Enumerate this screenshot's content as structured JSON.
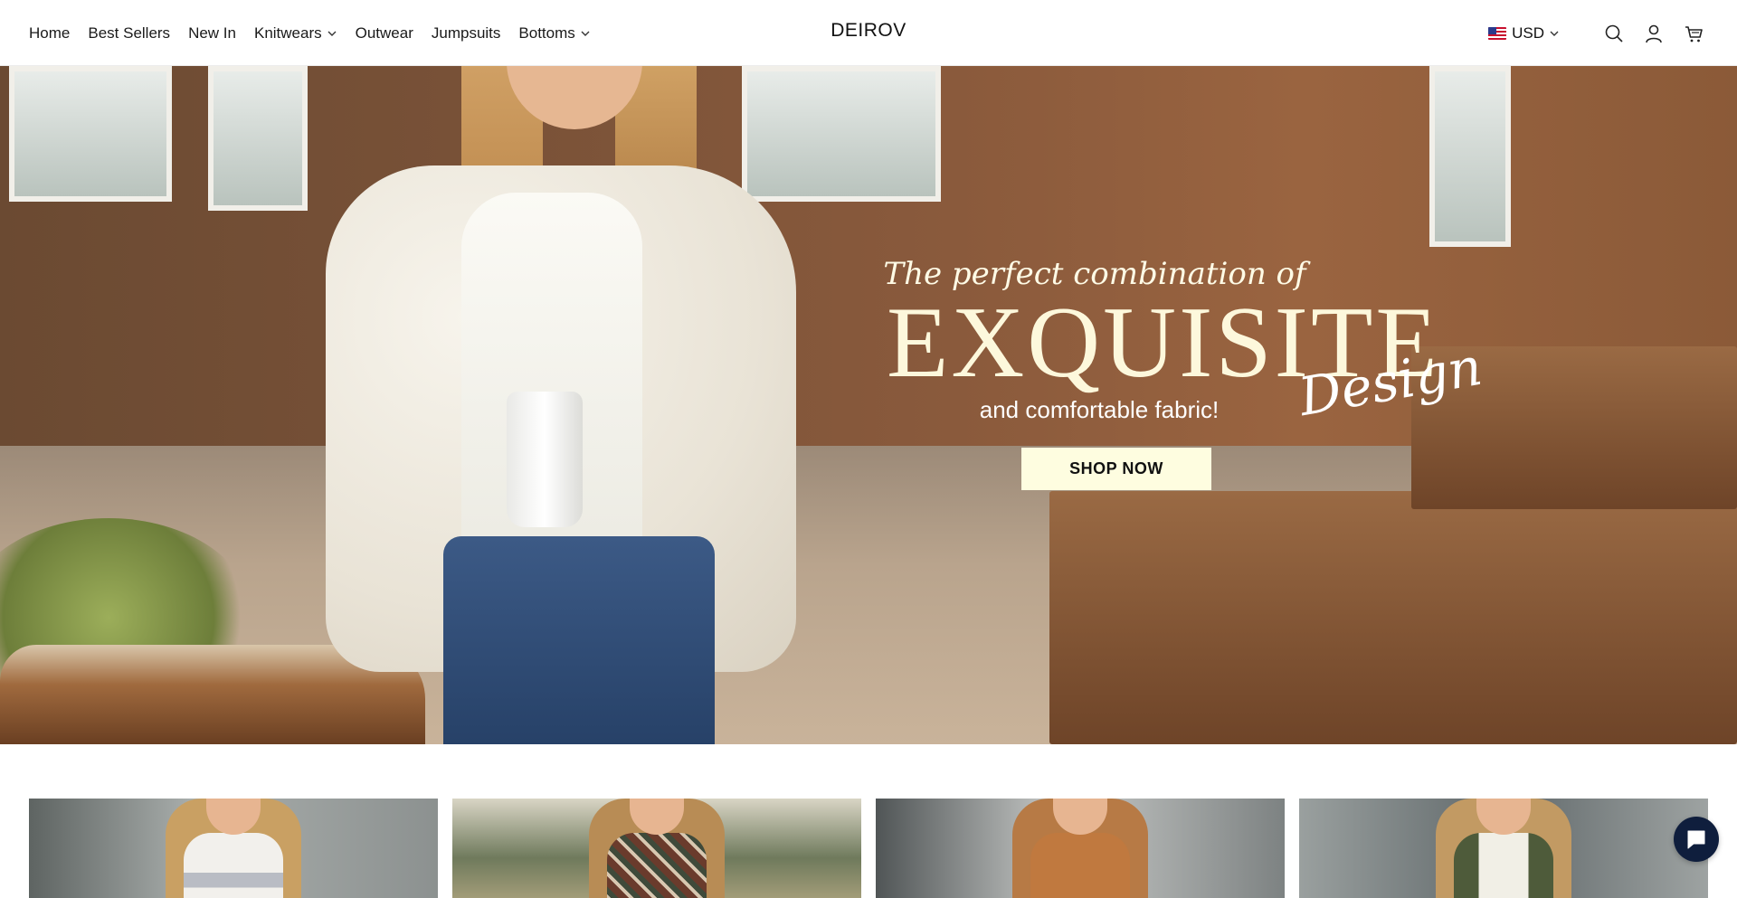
{
  "header": {
    "brand": "DEIROV",
    "nav": [
      {
        "label": "Home",
        "has_dropdown": false
      },
      {
        "label": "Best Sellers",
        "has_dropdown": false
      },
      {
        "label": "New In",
        "has_dropdown": false
      },
      {
        "label": "Knitwears",
        "has_dropdown": true
      },
      {
        "label": "Outwear",
        "has_dropdown": false
      },
      {
        "label": "Jumpsuits",
        "has_dropdown": false
      },
      {
        "label": "Bottoms",
        "has_dropdown": true
      }
    ],
    "currency": {
      "label": "USD",
      "flag": "us-flag-icon"
    },
    "icons": [
      "search-icon",
      "account-icon",
      "cart-icon"
    ]
  },
  "hero": {
    "tagline": "The perfect combination of",
    "headline": "EXQUISITE",
    "headline_script": "Design",
    "subline": "and comfortable fabric!",
    "cta": "SHOP NOW",
    "colors": {
      "headline": "#fdf8dc",
      "cta_bg": "#fefde0"
    }
  },
  "products": [
    {
      "name": "product-card-1",
      "bg": "#8e9494",
      "hair": "#c9a063",
      "top": "#eceae6"
    },
    {
      "name": "product-card-2",
      "bg": "#6f7a5c",
      "hair": "#b88c55",
      "top": "#6a3b2c"
    },
    {
      "name": "product-card-3",
      "bg": "#a8aaa8",
      "hair": "#b77a45",
      "top": "#c0793f"
    },
    {
      "name": "product-card-4",
      "bg": "#7a8280",
      "hair": "#c29a63",
      "top": "#4e5b3a"
    }
  ],
  "chat": {
    "icon": "chat-bubble-icon",
    "color": "#0f1e3d"
  }
}
